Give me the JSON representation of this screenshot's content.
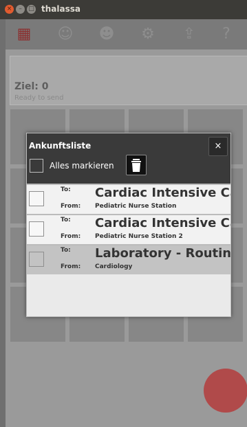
{
  "window": {
    "title": "thalassa"
  },
  "main": {
    "ziel": "Ziel: 0",
    "ready": "Ready to send"
  },
  "dialog": {
    "title": "Ankunftsliste",
    "close_label": "×",
    "select_all_label": "Alles markieren",
    "rows": [
      {
        "to_label": "To:",
        "from_label": "From:",
        "to": "Cardiac Intensive Care",
        "from": "Pediatric Nurse Station",
        "selected": false
      },
      {
        "to_label": "To:",
        "from_label": "From:",
        "to": "Cardiac Intensive Care",
        "from": "Pediatric Nurse Station 2",
        "selected": false
      },
      {
        "to_label": "To:",
        "from_label": "From:",
        "to": "Laboratory - Routine",
        "from": "Cardiology",
        "selected": true
      }
    ]
  }
}
